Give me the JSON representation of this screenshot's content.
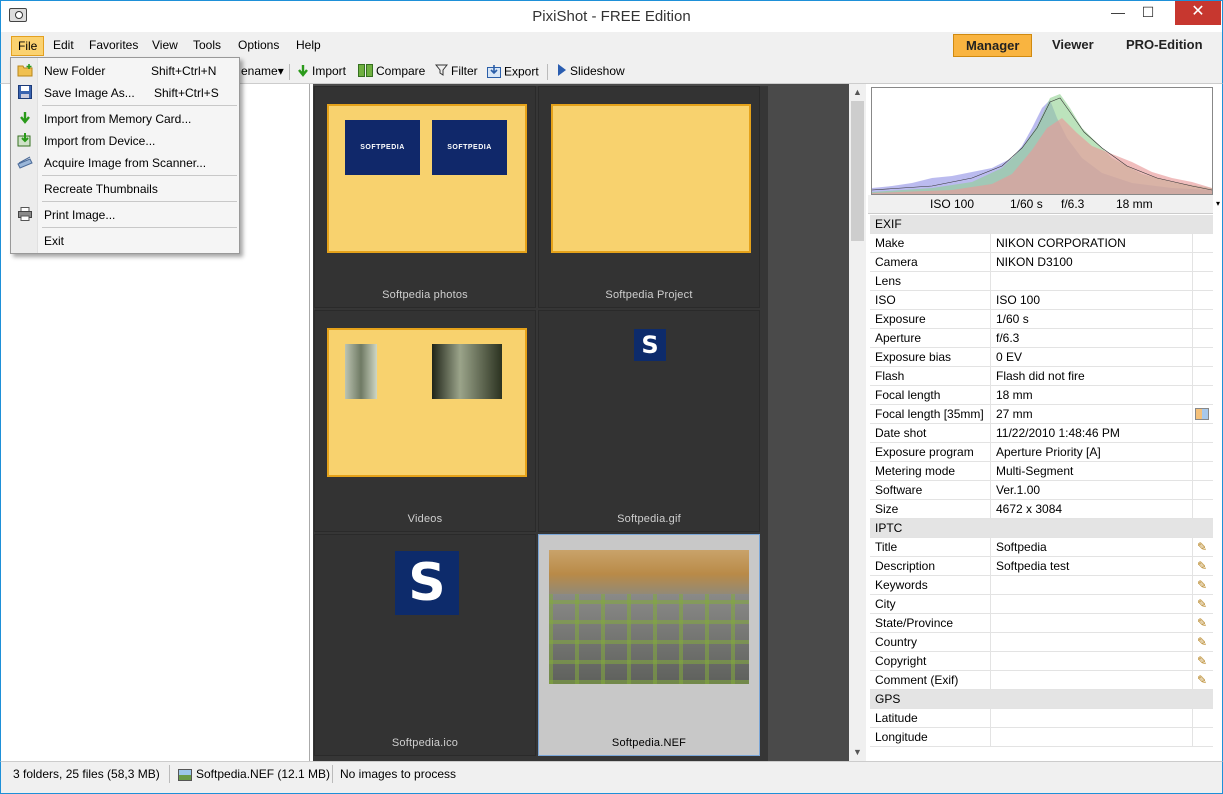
{
  "window": {
    "title": "PixiShot  -  FREE Edition",
    "minimize": "—",
    "maximize": "☐",
    "close": "✕"
  },
  "menubar": {
    "items": [
      "File",
      "Edit",
      "Favorites",
      "View",
      "Tools",
      "Options",
      "Help"
    ],
    "active": "File",
    "modes": [
      "Manager",
      "Viewer",
      "PRO-Edition"
    ],
    "active_mode": "Manager"
  },
  "toolbar": {
    "rename": "ename",
    "import": "Import",
    "compare": "Compare",
    "filter": "Filter",
    "export": "Export",
    "slideshow": "Slideshow"
  },
  "file_menu": {
    "items": [
      {
        "label": "New Folder",
        "shortcut": "Shift+Ctrl+N",
        "icon": "new-folder-icon"
      },
      {
        "label": "Save Image As...",
        "shortcut": "Shift+Ctrl+S",
        "icon": "save-icon"
      },
      {
        "label": "Import from Memory Card...",
        "shortcut": "",
        "icon": "import-arrow-icon"
      },
      {
        "label": "Import from Device...",
        "shortcut": "",
        "icon": "device-import-icon"
      },
      {
        "label": "Acquire Image from Scanner...",
        "shortcut": "",
        "icon": "scanner-icon"
      },
      {
        "label": "Recreate Thumbnails",
        "shortcut": "",
        "icon": ""
      },
      {
        "label": "Print Image...",
        "shortcut": "",
        "icon": "printer-icon"
      },
      {
        "label": "Exit",
        "shortcut": "",
        "icon": ""
      }
    ]
  },
  "thumbnails": [
    {
      "caption": "Softpedia photos",
      "kind": "folder"
    },
    {
      "caption": "Softpedia Project",
      "kind": "folder"
    },
    {
      "caption": "Videos",
      "kind": "folder"
    },
    {
      "caption": "Softpedia.gif",
      "kind": "image"
    },
    {
      "caption": "Softpedia.ico",
      "kind": "image"
    },
    {
      "caption": "Softpedia.NEF",
      "kind": "photo",
      "selected": true
    }
  ],
  "thumb_logo_text": "SOFTPEDIA",
  "s_letter": "S",
  "histogram_info": {
    "iso": "ISO 100",
    "shutter": "1/60 s",
    "aperture": "f/6.3",
    "focal": "18 mm"
  },
  "properties": [
    {
      "section": "EXIF"
    },
    {
      "key": "Make",
      "value": "NIKON CORPORATION"
    },
    {
      "key": "Camera",
      "value": "NIKON D3100"
    },
    {
      "key": "Lens",
      "value": ""
    },
    {
      "key": "ISO",
      "value": "ISO 100"
    },
    {
      "key": "Exposure",
      "value": "1/60 s"
    },
    {
      "key": "Aperture",
      "value": "f/6.3"
    },
    {
      "key": "Exposure bias",
      "value": "0 EV"
    },
    {
      "key": "Flash",
      "value": "Flash did not fire"
    },
    {
      "key": "Focal length",
      "value": "18 mm"
    },
    {
      "key": "Focal length [35mm]",
      "value": "27 mm",
      "calc": true
    },
    {
      "key": "Date shot",
      "value": "11/22/2010 1:48:46 PM"
    },
    {
      "key": "Exposure program",
      "value": "Aperture Priority [A]"
    },
    {
      "key": "Metering mode",
      "value": "Multi-Segment"
    },
    {
      "key": "Software",
      "value": "Ver.1.00"
    },
    {
      "key": "Size",
      "value": "4672 x 3084"
    },
    {
      "section": "IPTC"
    },
    {
      "key": "Title",
      "value": "Softpedia",
      "editable": true
    },
    {
      "key": "Description",
      "value": "Softpedia test",
      "editable": true
    },
    {
      "key": "Keywords",
      "value": "",
      "editable": true
    },
    {
      "key": "City",
      "value": "",
      "editable": true
    },
    {
      "key": "State/Province",
      "value": "",
      "editable": true
    },
    {
      "key": "Country",
      "value": "",
      "editable": true
    },
    {
      "key": "Copyright",
      "value": "",
      "editable": true
    },
    {
      "key": "Comment (Exif)",
      "value": "",
      "editable": true
    },
    {
      "section": "GPS"
    },
    {
      "key": "Latitude",
      "value": ""
    },
    {
      "key": "Longitude",
      "value": ""
    }
  ],
  "statusbar": {
    "counts": "3 folders,  25 files (58,3 MB)",
    "selected_file": "Softpedia.NEF  (12.1 MB)",
    "process": "No images to process"
  },
  "edit_glyph": "✎"
}
